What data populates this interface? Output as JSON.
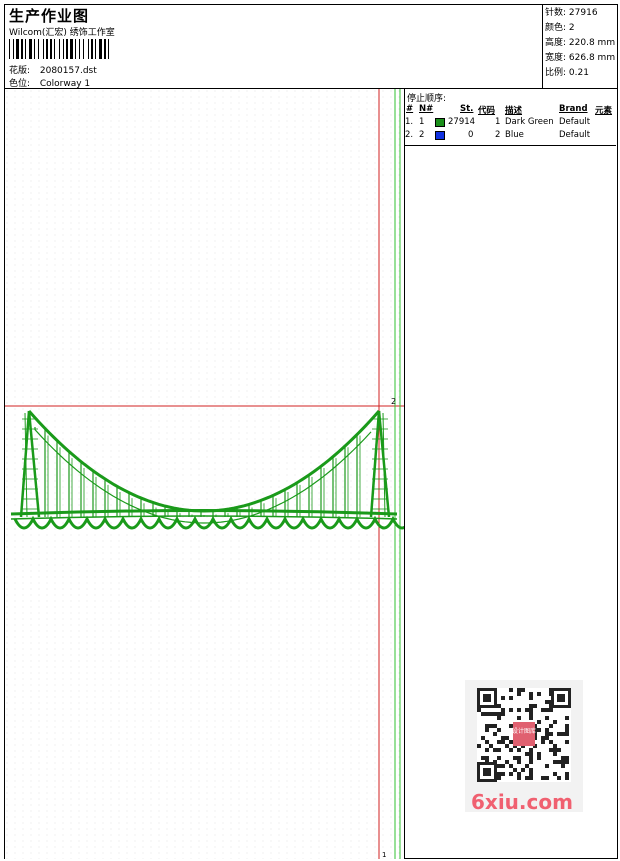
{
  "header": {
    "title": "生产作业图",
    "company": "Wilcom(汇宏) 绣饰工作室",
    "design_label": "花版:",
    "design_value": "2080157.dst",
    "colorway_label": "色位:",
    "colorway_value": "Colorway 1"
  },
  "stats": {
    "stitches_label": "针数:",
    "stitches_value": "27916",
    "colors_label": "颜色:",
    "colors_value": "2",
    "height_label": "高度:",
    "height_value": "220.8 mm",
    "width_label": "宽度:",
    "width_value": "626.8 mm",
    "scale_label": "比例:",
    "scale_value": "0.21"
  },
  "canvas": {
    "marker_label": "2",
    "marker_bottom": "1"
  },
  "stop_sequence": {
    "caption": "停止顺序:",
    "columns": [
      "#",
      "N#",
      "St.",
      "代码",
      "描述",
      "Brand",
      "元素"
    ],
    "rows": [
      {
        "idx": "1.",
        "n": "1",
        "color": "#1a8f1a",
        "st": "27914",
        "code": "1",
        "desc": "Dark Green",
        "brand": "Default"
      },
      {
        "idx": "2.",
        "n": "2",
        "color": "#1030e0",
        "st": "0",
        "code": "2",
        "desc": "Blue",
        "brand": "Default"
      }
    ]
  },
  "watermark": {
    "text": "6xiu.com",
    "stamp_text": "设计图库"
  },
  "colors": {
    "thread_green": "#1a9a1a",
    "guide_red": "#d02020",
    "guide_green": "#30c030"
  }
}
